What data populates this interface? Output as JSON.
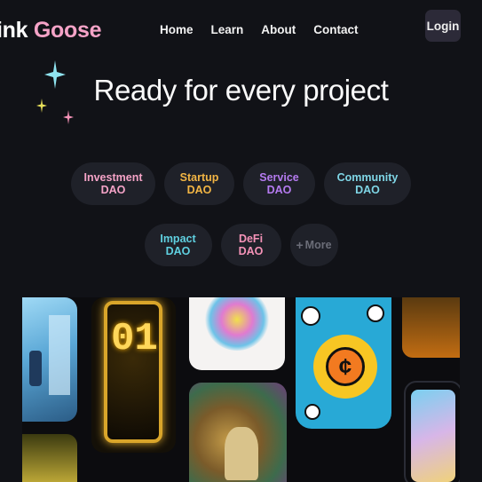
{
  "brand": {
    "prefix": "ink",
    "accent": "Goose",
    "prefix_color": "#ffffff",
    "accent_color": "#f5a3c7"
  },
  "nav": {
    "items": [
      "Home",
      "Learn",
      "About",
      "Contact"
    ],
    "login_label": "Login"
  },
  "hero": {
    "headline": "Ready for every project"
  },
  "categories": {
    "row1": [
      {
        "label": "Investment DAO",
        "color": "#f5a3c7",
        "icon": ""
      },
      {
        "label": "Startup DAO",
        "color": "#f2b544",
        "icon": ""
      },
      {
        "label": "Service DAO",
        "color": "#b57bf0",
        "icon": ""
      },
      {
        "label": "Community DAO",
        "color": "#7fd6e6",
        "icon": ""
      }
    ],
    "row2": [
      {
        "label": "Impact DAO",
        "color": "#5fd0e0",
        "icon": ""
      },
      {
        "label": "DeFi DAO",
        "color": "#f593b8",
        "icon": ""
      },
      {
        "label": "More",
        "color": "#6b6d78",
        "icon": "plus-icon"
      }
    ]
  },
  "gallery": {
    "card_labels": [
      "01"
    ]
  },
  "colors": {
    "background": "#111217",
    "chip_background": "#1f2129",
    "login_background": "#2c2a38"
  }
}
